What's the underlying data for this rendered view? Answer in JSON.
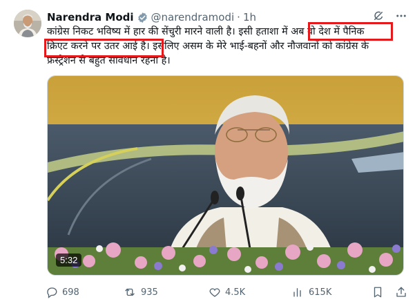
{
  "tweet": {
    "author_name": "Narendra Modi",
    "handle": "@narendramodi",
    "separator": "·",
    "time": "1h",
    "text_line1": "कांग्रेस निकट भविष्य में हार की सेंचुरी मारने वाली है। इसी हताशा में अब वो देश में पैनिक",
    "text_line2": "क्रिएट करने पर उतर आई है। इसलिए असम के मेरे भाई-बहनों और नौजवानों को कांग्रेस के",
    "text_line3": "फ्रस्ट्रेशन से बहुत सावधान रहना है।"
  },
  "media": {
    "type": "video",
    "duration": "5:32"
  },
  "actions": {
    "replies": "698",
    "reposts": "935",
    "likes": "4.5K",
    "views": "615K"
  },
  "icons": {
    "verified": "verified-badge-icon",
    "grok": "grok-icon",
    "more": "more-icon",
    "reply": "reply-icon",
    "repost": "repost-icon",
    "like": "like-icon",
    "views": "views-icon",
    "bookmark": "bookmark-icon",
    "share": "share-icon"
  },
  "colors": {
    "highlight": "#e3191c",
    "verified": "#829aab",
    "secondary_text": "#536471"
  }
}
